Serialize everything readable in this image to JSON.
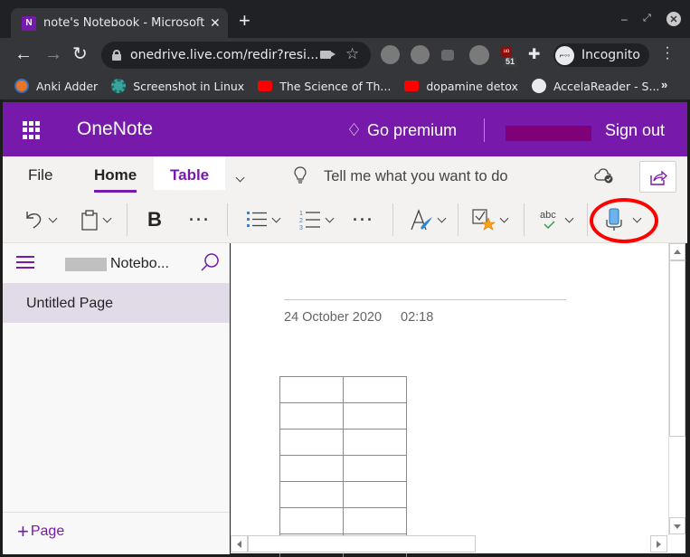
{
  "browser": {
    "tab": {
      "title": "note's Notebook - Microsoft OneNote Online",
      "favicon": "onenote-icon",
      "close_icon": "close-icon"
    },
    "new_tab_icon": "plus-icon",
    "window_controls": {
      "minimize": "–",
      "maximize": "⤢",
      "close": "✕"
    },
    "nav": {
      "back": "←",
      "forward": "→",
      "reload": "↻"
    },
    "url": "onedrive.live.com/redir?resi...",
    "incognito_label": "Incognito",
    "ublock_badge": "51",
    "bookmarks": [
      {
        "label": "Anki Adder",
        "icon": "anki-icon",
        "color": "#e8742a"
      },
      {
        "label": "Screenshot in Linux",
        "icon": "screenshot-app-icon",
        "color": "#3aa39b"
      },
      {
        "label": "The Science of Th...",
        "icon": "youtube-icon",
        "color": "#ff0000"
      },
      {
        "label": "dopamine detox",
        "icon": "youtube-icon",
        "color": "#ff0000"
      },
      {
        "label": "AccelaReader - S...",
        "icon": "globe-icon",
        "color": "#e8eaed"
      }
    ],
    "bookmarks_more": "»"
  },
  "onenote": {
    "app_name": "OneNote",
    "premium_label": "Go premium",
    "signout_label": "Sign out",
    "brand_color": "#7719aa",
    "ribbon_tabs": [
      {
        "label": "File",
        "active": false
      },
      {
        "label": "Home",
        "active": true
      },
      {
        "label": "Table",
        "active": false,
        "contextual": true
      }
    ],
    "tell_me_placeholder": "Tell me what you want to do",
    "commands": {
      "bold": "B",
      "more": "···"
    }
  },
  "sidebar": {
    "notebook_name": "Notebo...",
    "pages": [
      {
        "label": "Untitled Page",
        "selected": true
      }
    ],
    "add_page_label": "Page",
    "add_page_icon": "+"
  },
  "page": {
    "date": "24 October 2020",
    "time": "02:18",
    "table": {
      "columns": 2,
      "visible_rows": 6,
      "cells": [
        [
          "",
          ""
        ],
        [
          "",
          ""
        ],
        [
          "",
          ""
        ],
        [
          "",
          ""
        ],
        [
          "",
          ""
        ],
        [
          "",
          ""
        ]
      ]
    }
  },
  "annotation": {
    "color": "#ff0000",
    "target": "dictate-button"
  }
}
